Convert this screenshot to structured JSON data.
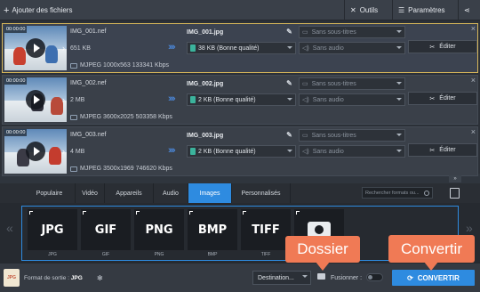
{
  "toolbar": {
    "add_files_label": "Ajouter des fichiers",
    "tools_label": "Outils",
    "settings_label": "Paramètres"
  },
  "files": [
    {
      "duration": "00:00:00",
      "name": "IMG_001.nef",
      "size": "651 KB",
      "meta": "MJPEG 1000x563 133341 Kbps",
      "output_name": "IMG_001.jpg",
      "output_quality": "38 KB (Bonne qualité)",
      "subtitles": "Sans sous-titres",
      "audio": "Sans audio",
      "edit_label": "Éditer",
      "selected": true
    },
    {
      "duration": "00:00:00",
      "name": "IMG_002.nef",
      "size": "2 MB",
      "meta": "MJPEG 3600x2025 503358 Kbps",
      "output_name": "IMG_002.jpg",
      "output_quality": "2 KB (Bonne qualité)",
      "subtitles": "Sans sous-titres",
      "audio": "Sans audio",
      "edit_label": "Éditer",
      "selected": false
    },
    {
      "duration": "00:00:00",
      "name": "IMG_003.nef",
      "size": "4 MB",
      "meta": "MJPEG 3500x1969 746620 Kbps",
      "output_name": "IMG_003.jpg",
      "output_quality": "2 KB (Bonne qualité)",
      "subtitles": "Sans sous-titres",
      "audio": "Sans audio",
      "edit_label": "Éditer",
      "selected": false
    }
  ],
  "tabs": [
    "Populaire",
    "Vidéo",
    "Appareils",
    "Audio",
    "Images",
    "Personnalisés"
  ],
  "active_tab": "Images",
  "search_placeholder": "Rechercher formats ou...",
  "formats": [
    {
      "logo": "JPG",
      "label": "JPG"
    },
    {
      "logo": "GIF",
      "label": "GIF"
    },
    {
      "logo": "PNG",
      "label": "PNG"
    },
    {
      "logo": "BMP",
      "label": "BMP"
    },
    {
      "logo": "TIFF",
      "label": "TIFF"
    },
    {
      "logo": "",
      "label": ""
    }
  ],
  "bottom": {
    "format_chip": "JPG",
    "output_format_label": "Format de sortie :",
    "output_format_value": "JPG",
    "destination_label": "Destination...",
    "merge_label": "Fusionner :",
    "convert_label": "CONVERTIR"
  },
  "callouts": {
    "folder": "Dossier",
    "convert": "Convertir"
  },
  "colors": {
    "accent": "#2e8be0",
    "callout": "#f07a55",
    "selected_border": "#d6b65a"
  }
}
